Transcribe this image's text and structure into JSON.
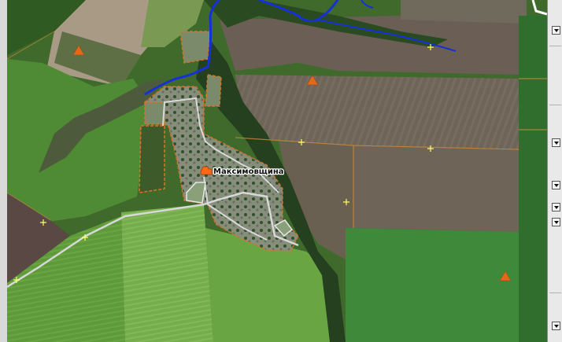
{
  "map": {
    "settlement": {
      "name": "Максимовщина"
    }
  },
  "colors": {
    "river": "#1530d8",
    "road": "#d8d8d8",
    "boundary": "#d5742a",
    "triangulation_marker": "#e06a1a",
    "grid_cross": "#ffff66",
    "settlement_marker": "#ff6a1a"
  },
  "icons": {
    "settlement": "settlement-icon",
    "elevation_point": "triangle-icon",
    "grid_marker": "cross-icon"
  },
  "right_panel": {
    "buttons": [
      "chevron-down-icon",
      "chevron-down-icon",
      "chevron-down-icon",
      "chevron-down-icon",
      "chevron-down-icon",
      "chevron-down-icon"
    ]
  }
}
